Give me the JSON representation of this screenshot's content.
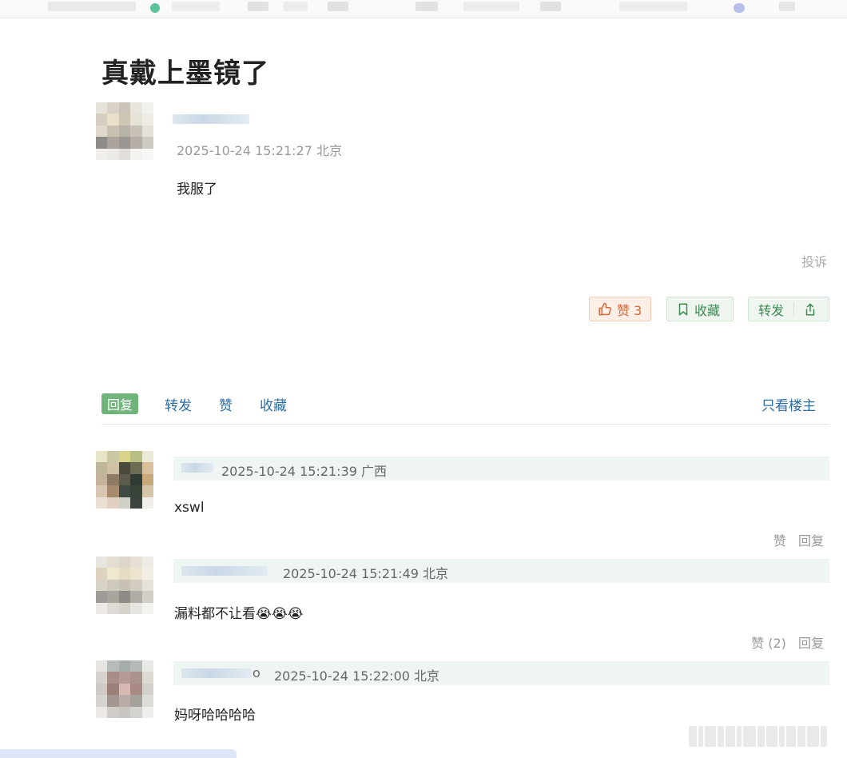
{
  "post": {
    "title": "真戴上墨镜了",
    "meta": "2025-10-24 15:21:27 北京",
    "body": "我服了",
    "report_label": "投诉",
    "like_label": "赞 3",
    "fav_label": "收藏",
    "share_label": "转发"
  },
  "tabs": {
    "reply": "回复",
    "share": "转发",
    "like": "赞",
    "fav": "收藏",
    "op_only": "只看楼主"
  },
  "replies": [
    {
      "meta": "2025-10-24 15:21:39 广西",
      "body": "xswl",
      "like_label": "赞",
      "reply_label": "回复"
    },
    {
      "meta": "2025-10-24 15:21:49 北京",
      "body": "漏料都不让看😭😭😭",
      "like_label": "赞 (2)",
      "reply_label": "回复"
    },
    {
      "meta": "2025-10-24 15:22:00 北京",
      "body": "妈呀哈哈哈哈",
      "name_tail": "o"
    }
  ],
  "icons": {
    "like": "thumbs-up-icon",
    "fav": "bookmark-icon",
    "share": "share-icon"
  },
  "colors": {
    "like_text": "#d2693a",
    "fav_text": "#3f8a55",
    "tab_active_bg": "#6fb57b",
    "link": "#2d6ea3"
  }
}
